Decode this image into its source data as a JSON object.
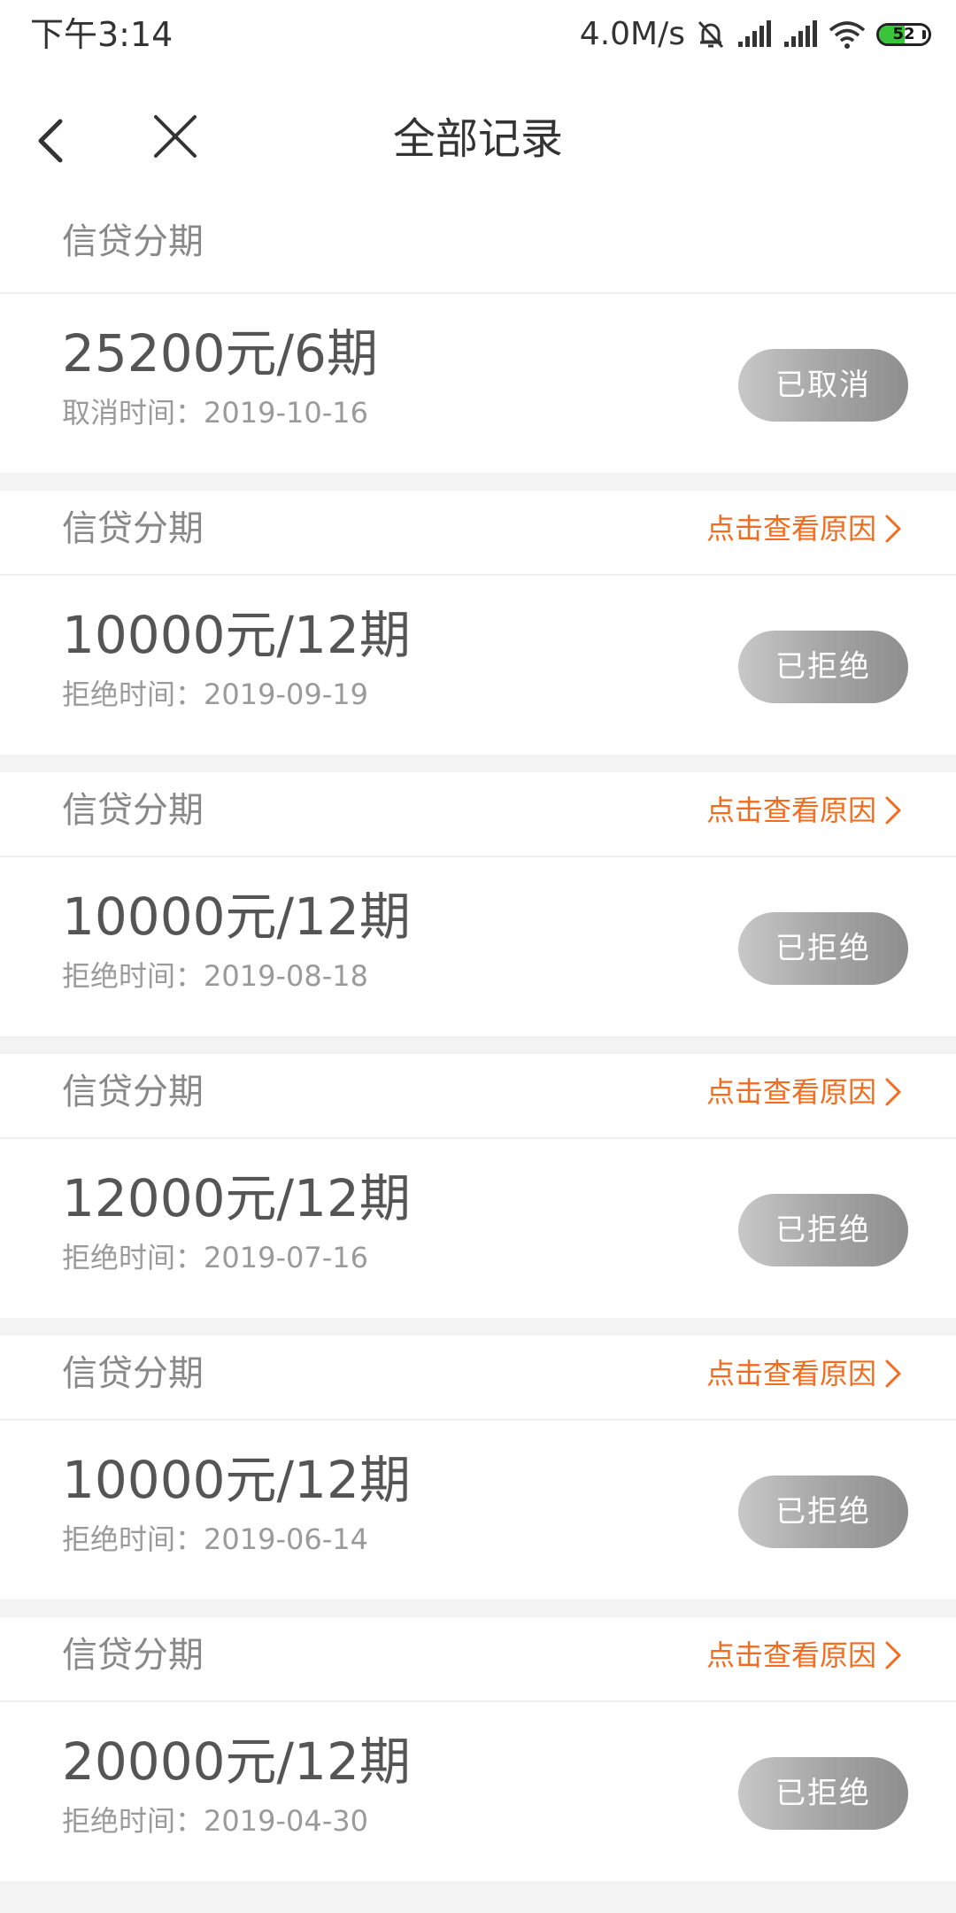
{
  "status_bar": {
    "time": "下午3:14",
    "net_speed": "4.0M/s",
    "battery_level": "52",
    "battery_fill": 0.52,
    "icons": [
      "mute-bell-icon",
      "signal-icon",
      "signal-icon",
      "wifi-icon",
      "battery-icon"
    ]
  },
  "nav": {
    "title": "全部记录",
    "back_icon": "chevron-left-icon",
    "close_icon": "close-icon"
  },
  "colors": {
    "accent": "#f36b1c",
    "pill_gray": "#a6a6a6",
    "text_primary": "#555555",
    "text_secondary": "#9a9a9a"
  },
  "records": [
    {
      "type": "信贷分期",
      "reason_link": "",
      "amount": "25200元/6期",
      "time": "取消时间：2019-10-16",
      "status": "已取消"
    },
    {
      "type": "信贷分期",
      "reason_link": "点击查看原因",
      "amount": "10000元/12期",
      "time": "拒绝时间：2019-09-19",
      "status": "已拒绝"
    },
    {
      "type": "信贷分期",
      "reason_link": "点击查看原因",
      "amount": "10000元/12期",
      "time": "拒绝时间：2019-08-18",
      "status": "已拒绝"
    },
    {
      "type": "信贷分期",
      "reason_link": "点击查看原因",
      "amount": "12000元/12期",
      "time": "拒绝时间：2019-07-16",
      "status": "已拒绝"
    },
    {
      "type": "信贷分期",
      "reason_link": "点击查看原因",
      "amount": "10000元/12期",
      "time": "拒绝时间：2019-06-14",
      "status": "已拒绝"
    },
    {
      "type": "信贷分期",
      "reason_link": "点击查看原因",
      "amount": "20000元/12期",
      "time": "拒绝时间：2019-04-30",
      "status": "已拒绝"
    }
  ]
}
